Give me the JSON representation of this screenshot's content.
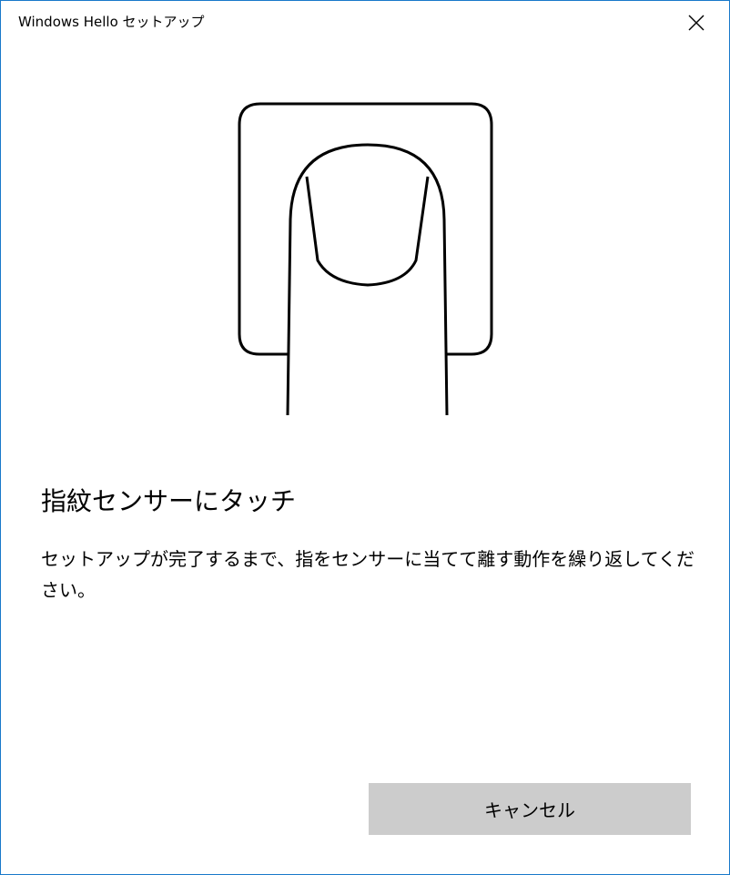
{
  "window": {
    "title": "Windows Hello セットアップ",
    "border_color": "#1979ca"
  },
  "illustration": {
    "icon": "fingerprint-sensor-touch-icon"
  },
  "content": {
    "heading": "指紋センサーにタッチ",
    "instruction": "セットアップが完了するまで、指をセンサーに当てて離す動作を繰り返してください。"
  },
  "buttons": {
    "cancel_label": "キャンセル",
    "cancel_color": "#cccccc"
  }
}
